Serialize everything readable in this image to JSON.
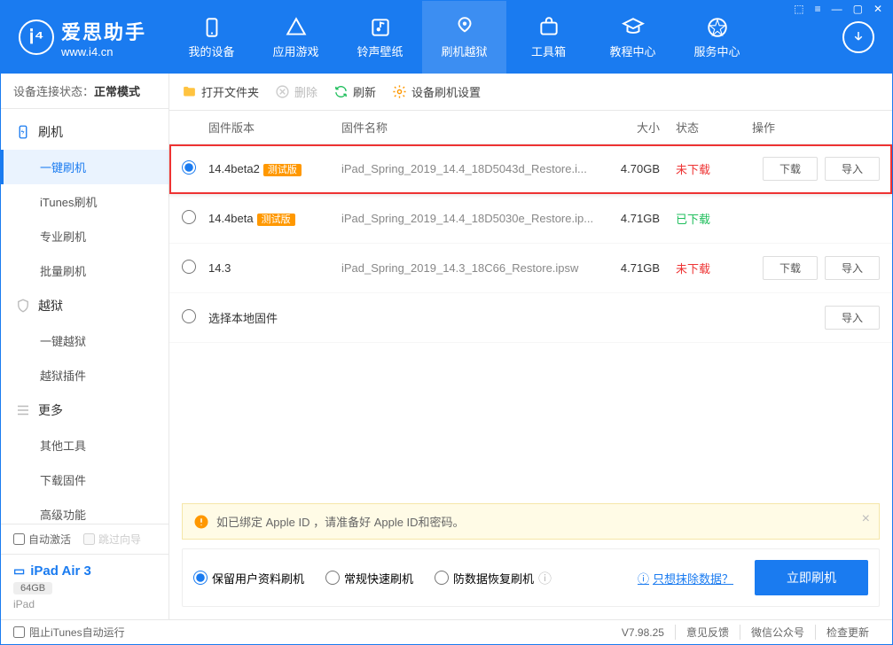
{
  "window": {
    "title": "爱思助手",
    "subtitle": "www.i4.cn"
  },
  "nav": [
    {
      "label": "我的设备",
      "icon": "device"
    },
    {
      "label": "应用游戏",
      "icon": "apps"
    },
    {
      "label": "铃声壁纸",
      "icon": "media"
    },
    {
      "label": "刷机越狱",
      "icon": "flash",
      "active": true
    },
    {
      "label": "工具箱",
      "icon": "tools"
    },
    {
      "label": "教程中心",
      "icon": "tutorial"
    },
    {
      "label": "服务中心",
      "icon": "service"
    }
  ],
  "sidebar": {
    "conn_label": "设备连接状态：",
    "conn_value": "正常模式",
    "groups": [
      {
        "label": "刷机",
        "icon": "flash",
        "items": [
          "一键刷机",
          "iTunes刷机",
          "专业刷机",
          "批量刷机"
        ],
        "activeIndex": 0
      },
      {
        "label": "越狱",
        "icon": "shield",
        "items": [
          "一键越狱",
          "越狱插件"
        ]
      },
      {
        "label": "更多",
        "icon": "more",
        "items": [
          "其他工具",
          "下载固件",
          "高级功能"
        ]
      }
    ],
    "auto_activate": "自动激活",
    "skip_guide": "跳过向导",
    "device": {
      "name": "iPad Air 3",
      "capacity": "64GB",
      "type": "iPad"
    }
  },
  "toolbar": {
    "open": "打开文件夹",
    "delete": "删除",
    "refresh": "刷新",
    "settings": "设备刷机设置"
  },
  "table": {
    "headers": {
      "version": "固件版本",
      "name": "固件名称",
      "size": "大小",
      "status": "状态",
      "ops": "操作"
    },
    "rows": [
      {
        "version": "14.4beta2",
        "beta": "测试版",
        "name": "iPad_Spring_2019_14.4_18D5043d_Restore.i...",
        "size": "4.70GB",
        "status": "未下载",
        "status_cls": "nd",
        "selected": true,
        "highlight": true,
        "showBtns": true
      },
      {
        "version": "14.4beta",
        "beta": "测试版",
        "name": "iPad_Spring_2019_14.4_18D5030e_Restore.ip...",
        "size": "4.71GB",
        "status": "已下载",
        "status_cls": "dl",
        "showBtns": false
      },
      {
        "version": "14.3",
        "beta": "",
        "name": "iPad_Spring_2019_14.3_18C66_Restore.ipsw",
        "size": "4.71GB",
        "status": "未下载",
        "status_cls": "nd",
        "showBtns": true
      },
      {
        "version": "选择本地固件",
        "beta": "",
        "name": "",
        "size": "",
        "status": "",
        "status_cls": "",
        "showImport": true
      }
    ],
    "btn_download": "下载",
    "btn_import": "导入"
  },
  "alert": {
    "text": "如已绑定 Apple ID ，请准备好 Apple ID和密码。"
  },
  "flash_opts": {
    "opt1": "保留用户资料刷机",
    "opt2": "常规快速刷机",
    "opt3": "防数据恢复刷机",
    "erase": "只想抹除数据？",
    "action": "立即刷机"
  },
  "statusbar": {
    "block_itunes": "阻止iTunes自动运行",
    "version": "V7.98.25",
    "feedback": "意见反馈",
    "wechat": "微信公众号",
    "check_update": "检查更新"
  }
}
